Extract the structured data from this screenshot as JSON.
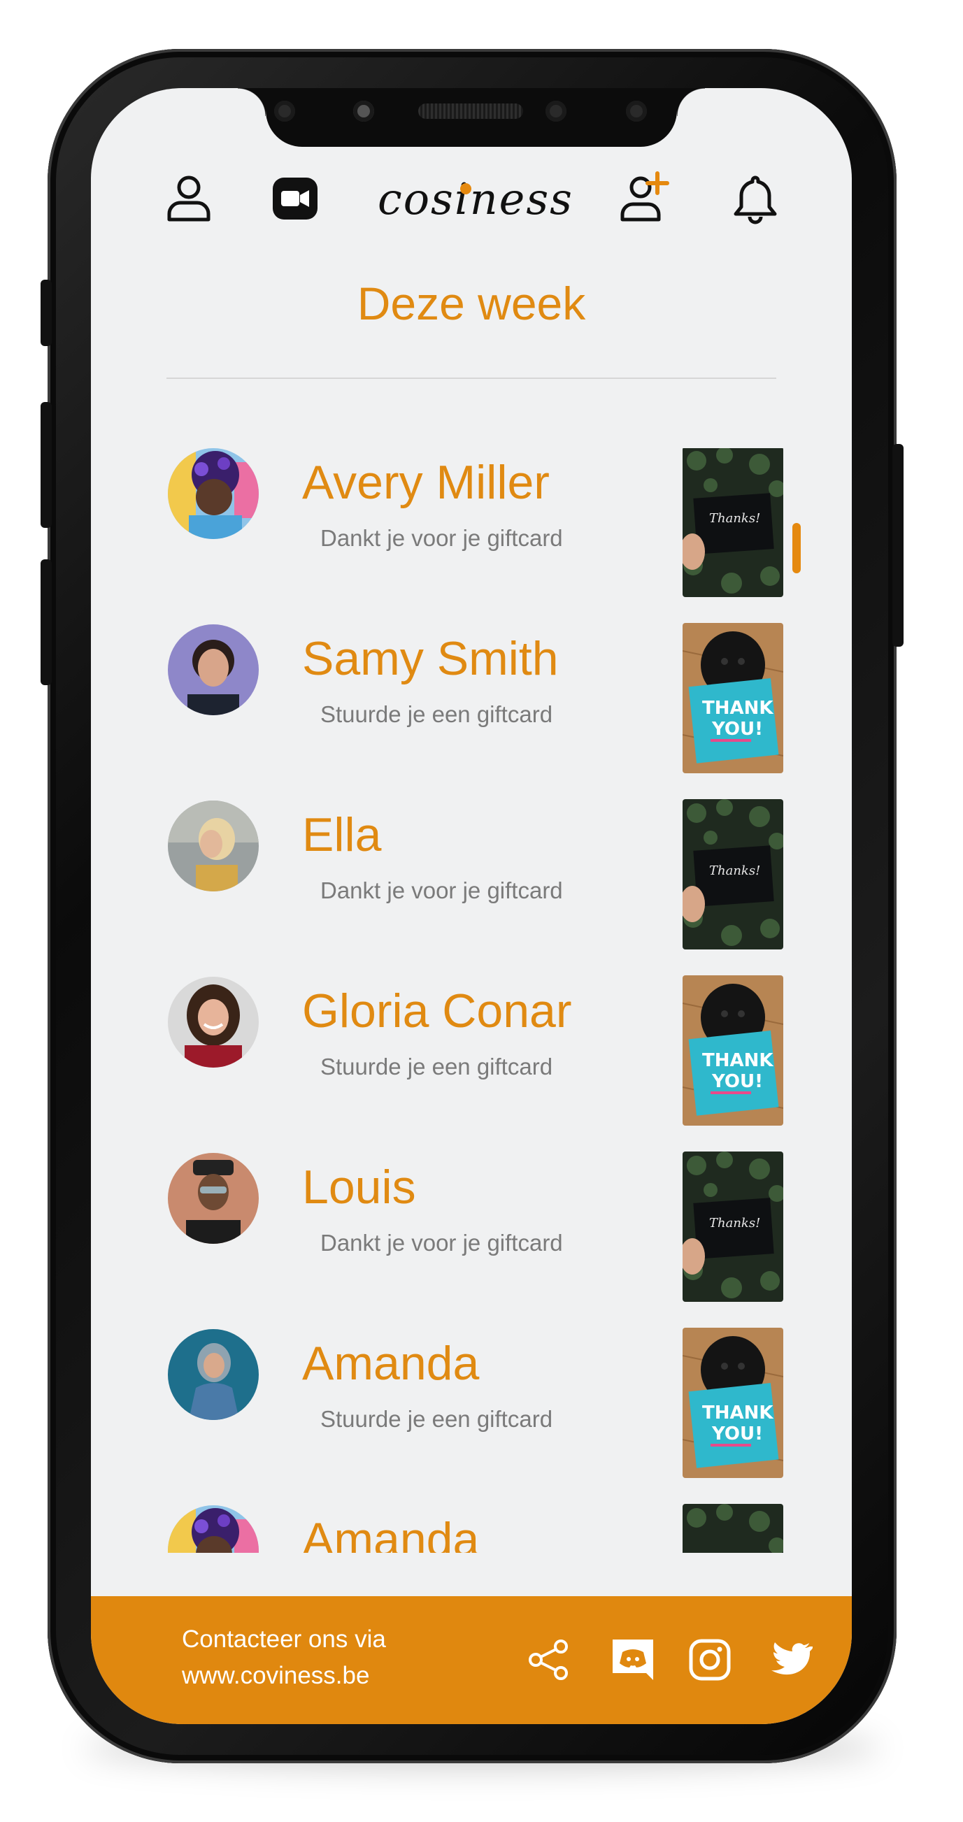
{
  "brand": {
    "logo_text": "cosiness",
    "accent_color": "#e08a12"
  },
  "header": {
    "icons": [
      "profile-icon",
      "video-call-icon",
      "add-user-icon",
      "bell-icon"
    ]
  },
  "page_title": "Deze week",
  "feed": [
    {
      "name": "Avery Miller",
      "message": "Dankt je voor je giftcard",
      "card": "thanks-card"
    },
    {
      "name": "Samy Smith",
      "message": "Stuurde je een giftcard",
      "card": "thank-you-dog-card"
    },
    {
      "name": "Ella",
      "message": "Dankt je voor je giftcard",
      "card": "thanks-card"
    },
    {
      "name": "Gloria Conar",
      "message": "Stuurde je een giftcard",
      "card": "thank-you-dog-card"
    },
    {
      "name": "Louis",
      "message": "Dankt je voor je giftcard",
      "card": "thanks-card"
    },
    {
      "name": "Amanda",
      "message": "Stuurde je een giftcard",
      "card": "thank-you-dog-card"
    },
    {
      "name": "Amanda",
      "message": "",
      "card": "thanks-card"
    }
  ],
  "footer": {
    "line1": "Contacteer ons via",
    "line2": "www.coviness.be",
    "icons": [
      "share-icon",
      "discord-icon",
      "instagram-icon",
      "twitter-icon"
    ]
  }
}
